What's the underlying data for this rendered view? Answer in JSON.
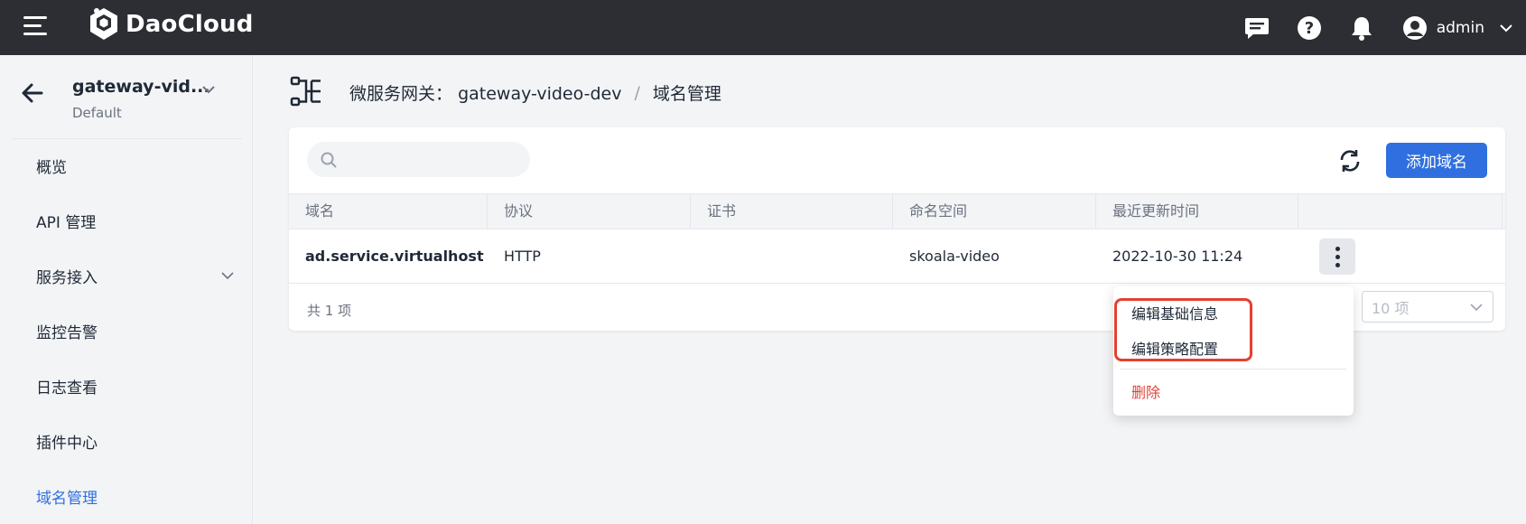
{
  "app": {
    "brand": "DaoCloud",
    "brand_color": "#2c2e33",
    "accent": "#2f6fe0",
    "danger": "#e0443a"
  },
  "topbar": {
    "icons": [
      "menu-icon",
      "message-icon",
      "help-icon",
      "bell-icon",
      "user-icon",
      "chevron-down-icon"
    ],
    "user_name": "admin"
  },
  "sidebar": {
    "gateway_name": "gateway-vid...",
    "namespace": "Default",
    "items": [
      {
        "label": "概览",
        "active": false
      },
      {
        "label": "API 管理",
        "active": false
      },
      {
        "label": "服务接入",
        "active": false,
        "expandable": true
      },
      {
        "label": "监控告警",
        "active": false
      },
      {
        "label": "日志查看",
        "active": false
      },
      {
        "label": "插件中心",
        "active": false
      },
      {
        "label": "域名管理",
        "active": true
      }
    ]
  },
  "breadcrumb": {
    "parent": "微服务网关：",
    "gateway": "gateway-video-dev",
    "separator": "/",
    "current": "域名管理"
  },
  "toolbar": {
    "search_placeholder": "",
    "add_label": "添加域名"
  },
  "table": {
    "columns": [
      "域名",
      "协议",
      "证书",
      "命名空间",
      "最近更新时间",
      ""
    ],
    "rows": [
      {
        "domain": "ad.service.virtualhost",
        "protocol": "HTTP",
        "certificate": "",
        "namespace": "skoala-video",
        "updated": "2022-10-30 11:24"
      }
    ],
    "total_label": "共 1 项",
    "page_size": "10 项"
  },
  "menu": {
    "items": [
      {
        "label": "编辑基础信息"
      },
      {
        "label": "编辑策略配置"
      },
      {
        "label": "删除",
        "danger": true
      }
    ]
  }
}
